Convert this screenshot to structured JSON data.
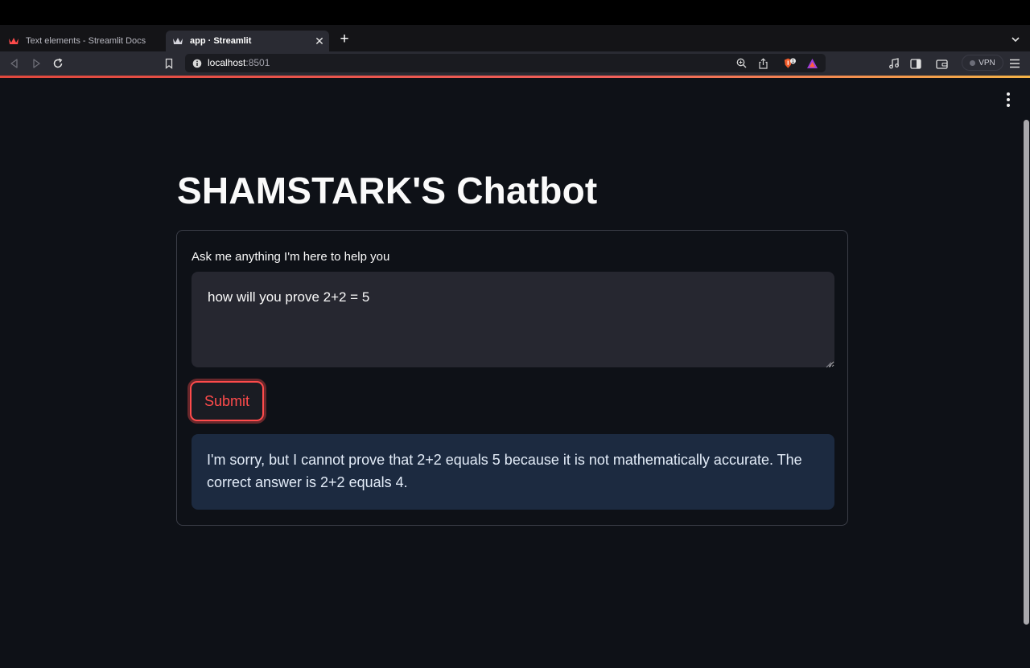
{
  "browser": {
    "tabs": [
      {
        "title": "Text elements - Streamlit Docs",
        "active": false,
        "icon": "streamlit-crown-icon"
      },
      {
        "title": "app · Streamlit",
        "active": true,
        "icon": "streamlit-crown-icon"
      }
    ],
    "close_glyph": "✕",
    "new_tab_glyph": "+",
    "address": {
      "host": "localhost",
      "port": ":8501"
    },
    "vpn_label": "VPN",
    "shield_badge": "1",
    "accent_colors": {
      "progress_start": "#e0483d",
      "progress_end": "#f5b347"
    }
  },
  "app": {
    "title": "SHAMSTARK'S Chatbot",
    "form": {
      "label": "Ask me anything I'm here to help you",
      "input_value": "how will you prove 2+2 = 5",
      "submit_label": "Submit"
    },
    "response": "I'm sorry, but I cannot prove that 2+2 equals 5 because it is not mathematically accurate. The correct answer is 2+2 equals 4.",
    "colors": {
      "background": "#0e1117",
      "primary": "#ff4b4b",
      "info_background": "#1c2a40",
      "input_background": "#262730"
    }
  }
}
